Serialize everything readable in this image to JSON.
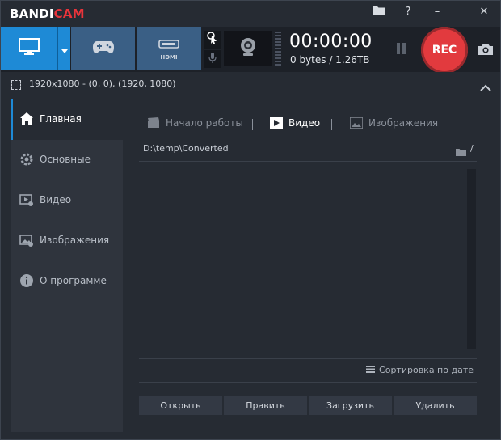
{
  "app": {
    "logo_main": "BANDI",
    "logo_accent": "CAM"
  },
  "titlebar": {
    "buttons": [
      {
        "name": "folder-icon"
      },
      {
        "name": "help-icon",
        "glyph": "?"
      },
      {
        "name": "minimize-icon",
        "glyph": "–"
      },
      {
        "name": "close-icon",
        "glyph": "✕"
      }
    ]
  },
  "toolbar": {
    "modes": [
      {
        "name": "screen-mode",
        "icon": "monitor-icon",
        "active": true
      },
      {
        "name": "game-mode",
        "icon": "gamepad-icon",
        "active": false
      },
      {
        "name": "hdmi-mode",
        "icon": "hdmi-icon",
        "active": false
      }
    ],
    "hdmi_label": "HDMI",
    "timer": "00:00:00",
    "size": "0 bytes / 1.26TB",
    "rec_label": "REC"
  },
  "infobar": {
    "text": "1920x1080 - (0, 0), (1920, 1080)"
  },
  "sidebar": {
    "items": [
      {
        "label": "Главная",
        "icon": "home-icon",
        "active": true
      },
      {
        "label": "Основные",
        "icon": "gear-icon",
        "active": false
      },
      {
        "label": "Видео",
        "icon": "video-settings-icon",
        "active": false
      },
      {
        "label": "Изображения",
        "icon": "image-settings-icon",
        "active": false
      },
      {
        "label": "О программе",
        "icon": "info-icon",
        "active": false
      }
    ]
  },
  "main": {
    "tabs": [
      {
        "label": "Начало работы",
        "icon": "clapperboard-icon",
        "active": false
      },
      {
        "label": "Видео",
        "icon": "play-icon",
        "active": true
      },
      {
        "label": "Изображения",
        "icon": "picture-icon",
        "active": false
      }
    ],
    "path": "D:\\temp\\Converted",
    "path_trailing": "/",
    "sort_label": "Сортировка по дате",
    "buttons": [
      "Открыть",
      "Править",
      "Загрузить",
      "Удалить"
    ]
  },
  "colors": {
    "accent": "#1e8ad6",
    "rec": "#e23a3e",
    "background": "#262b33",
    "sidebar": "#2f343d"
  }
}
